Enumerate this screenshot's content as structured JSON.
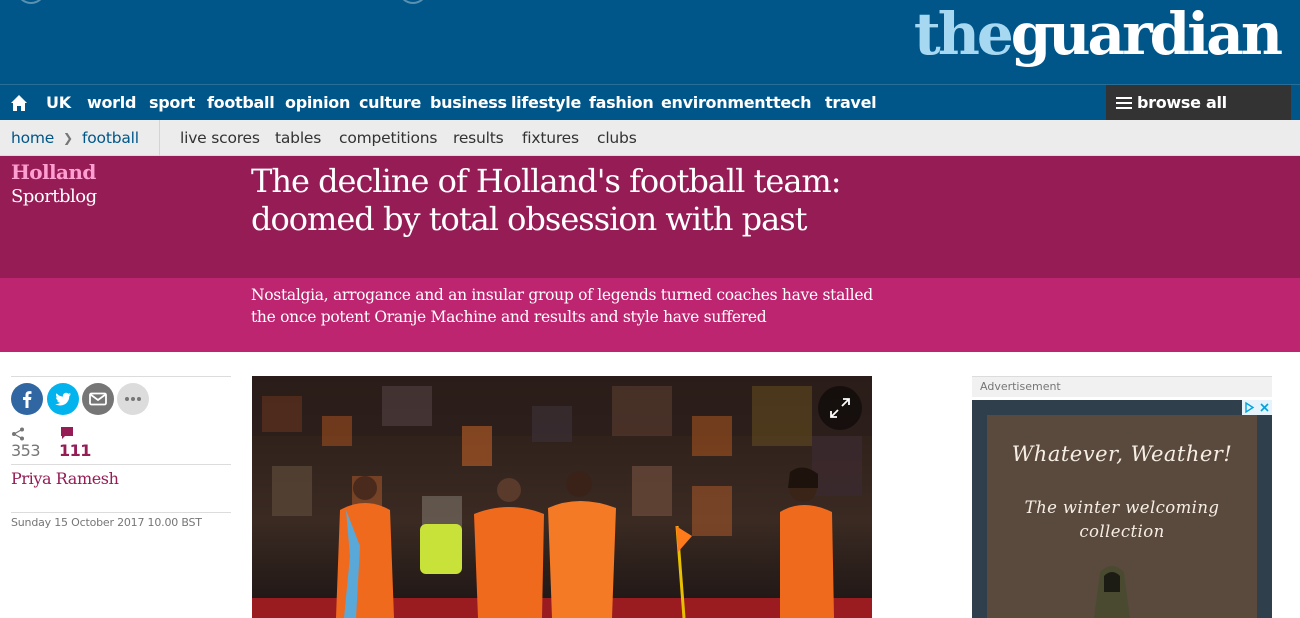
{
  "masthead": {
    "logo_the": "the",
    "logo_guardian": "guardian"
  },
  "nav": {
    "home_icon": "home-icon",
    "items": [
      "UK",
      "world",
      "sport",
      "football",
      "opinion",
      "culture",
      "business",
      "lifestyle",
      "fashion",
      "environment",
      "tech",
      "travel"
    ],
    "browse_label": "browse all sections",
    "browse_icon": "menu-icon"
  },
  "subnav": {
    "breadcrumb": [
      "home",
      "football"
    ],
    "items": [
      "live scores",
      "tables",
      "competitions",
      "results",
      "fixtures",
      "clubs"
    ]
  },
  "article": {
    "kicker": "Holland",
    "series": "Sportblog",
    "headline": "The decline of Holland's football team: doomed by total obsession with past",
    "standfirst": "Nostalgia, arrogance and an insular group of legends turned coaches have stalled the once potent Oranje Machine and results and style have suffered",
    "share_count": "353",
    "comment_count": "111",
    "byline": "Priya Ramesh",
    "dateline": "Sunday 15 October 2017 10.00 BST",
    "share_buttons": [
      "facebook-icon",
      "twitter-icon",
      "email-icon",
      "more-icon"
    ]
  },
  "advert": {
    "label": "Advertisement",
    "headline": "Whatever, Weather!",
    "subline": "The winter welcoming collection"
  },
  "colors": {
    "guardian_blue": "#005689",
    "sport_dark": "#951c55",
    "sport_light": "#bd2570",
    "kicker_pink": "#ff9ed1"
  }
}
